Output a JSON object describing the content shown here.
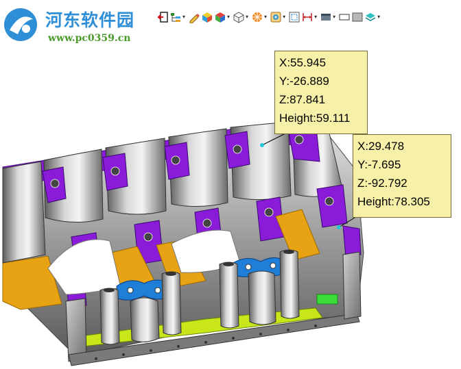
{
  "watermark": {
    "site_name": "河东软件园",
    "url": "www.pc0359.cn"
  },
  "toolbar": {
    "buttons": [
      {
        "icon": "exit-icon",
        "dropdown": false
      },
      {
        "icon": "layer-tree-icon",
        "dropdown": true
      },
      {
        "icon": "measure-pencil-icon",
        "dropdown": false
      },
      {
        "icon": "cube-color-icon",
        "dropdown": false
      },
      {
        "icon": "cube-shaded-icon",
        "dropdown": true
      },
      {
        "icon": "cube-wireframe-icon",
        "dropdown": true
      },
      {
        "icon": "explode-icon",
        "dropdown": true
      },
      {
        "icon": "gear-target-icon",
        "dropdown": true
      },
      {
        "icon": "fit-view-icon",
        "dropdown": false
      },
      {
        "icon": "dimension-icon",
        "dropdown": true
      },
      {
        "icon": "display-mode-icon",
        "dropdown": true
      },
      {
        "icon": "rectangle-outline-icon",
        "dropdown": false
      },
      {
        "icon": "rectangle-filled-icon",
        "dropdown": false
      },
      {
        "icon": "layers-cyan-icon",
        "dropdown": true
      }
    ]
  },
  "annotations": [
    {
      "x": "X:55.945",
      "y": "Y:-26.889",
      "z": "Z:87.841",
      "height": "Height:59.111"
    },
    {
      "x": "X:29.478",
      "y": "Y:-7.695",
      "z": "Z:-92.792",
      "height": "Height:78.305"
    }
  ],
  "colors": {
    "purple": "#8a1bd8",
    "orange": "#e8a314",
    "yellow_green": "#c8e61a",
    "blue": "#1f7fd8",
    "callout_bg": "#f7f0a8",
    "metal": "#9a9a9a"
  }
}
